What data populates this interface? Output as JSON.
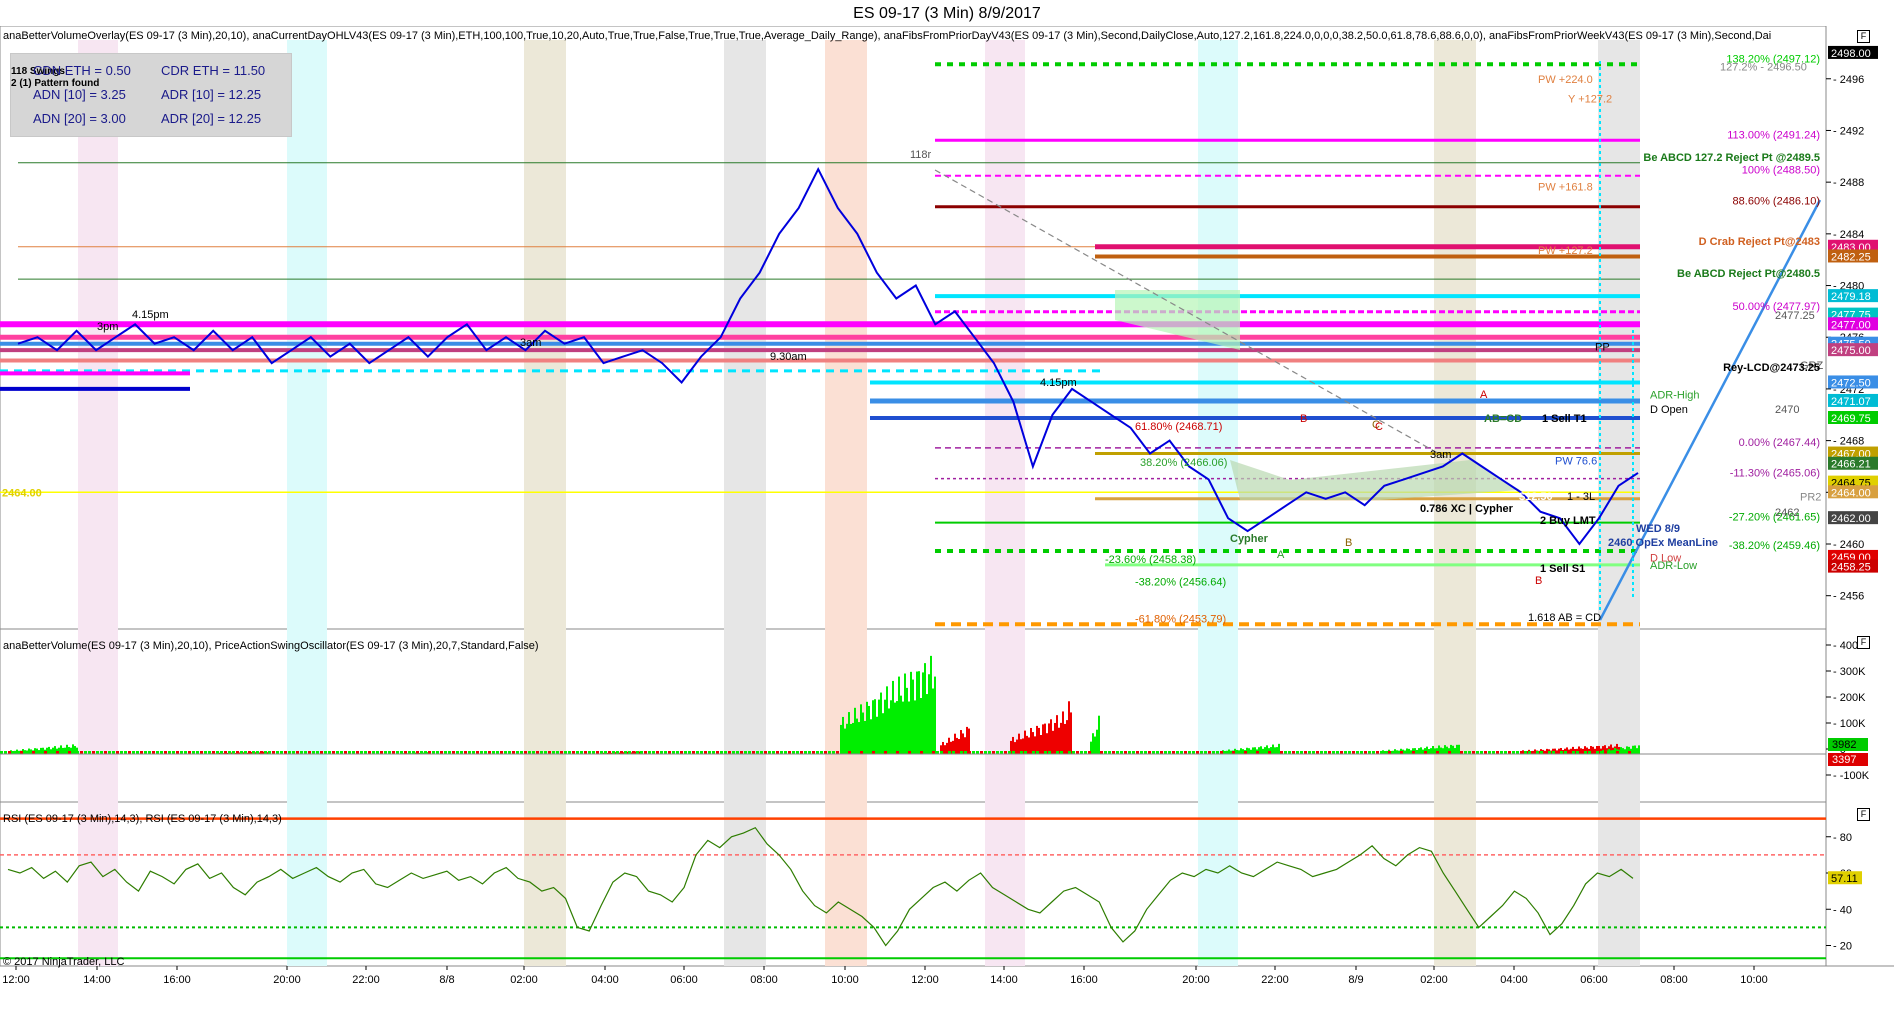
{
  "window": {
    "title": "ES 09-17 (3 Min)  8/9/2017"
  },
  "panels": {
    "price_label": "anaBetterVolumeOverlay(ES 09-17 (3 Min),20,10), anaCurrentDayOHLV43(ES 09-17 (3 Min),ETH,100,100,True,10,20,Auto,True,True,False,True,True,True,Average_Daily_Range), anaFibsFromPriorDayV43(ES 09-17 (3 Min),Second,DailyClose,Auto,127.2,161.8,224.0,0,0,0,38.2,50.0,61.8,78.6,88.6,0,0), anaFibsFromPriorWeekV43(ES 09-17 (3 Min),Second,Dai",
    "volume_label": "anaBetterVolume(ES 09-17 (3 Min),20,10), PriceActionSwingOscillator(ES 09-17 (3 Min),20,7,Standard,False)",
    "rsi_label": "RSI (ES 09-17 (3 Min),14,3), RSI (ES 09-17 (3 Min),14,3)"
  },
  "info_box": {
    "cdn_eth": "CDN ETH = 0.50",
    "cdr_eth": "CDR ETH = 11.50",
    "adn10": "ADN [10] = 3.25",
    "adr10": "ADR [10] = 12.25",
    "adn20": "ADN [20] = 3.00",
    "adr20": "ADR [20] = 12.25",
    "swings": "118 Swings",
    "pattern": "2 (1) Pattern found"
  },
  "copyright": "© 2017 NinjaTrader, LLC",
  "colors": {
    "fib_green": "#00cc00",
    "magenta": "#ff00ff",
    "blue": "#0000dd",
    "cyan": "#00e5ff",
    "orange": "#ff9900",
    "darkred": "#8b0000",
    "yellow": "#ffff00",
    "rsi": "#2e7d00",
    "vol_up": "#00ee00",
    "vol_down": "#ee0000",
    "steel": "#3a8ee6"
  },
  "chart_data": [
    {
      "type": "line",
      "panel": "price",
      "ylim": [
        2453.5,
        2499
      ],
      "y_ticks": [
        2456,
        2460,
        2464,
        2468,
        2472,
        2476,
        2480,
        2484,
        2488,
        2492,
        2496
      ],
      "x_tick_labels": [
        "12:00",
        "14:00",
        "16:00",
        "20:00",
        "22:00",
        "8/8",
        "02:00",
        "04:00",
        "06:00",
        "08:00",
        "10:00",
        "12:00",
        "14:00",
        "16:00",
        "20:00",
        "22:00",
        "8/9",
        "02:00",
        "04:00",
        "06:00",
        "08:00",
        "10:00"
      ],
      "current_price": 2464.0,
      "left_price_label": "2464.00",
      "series": [
        {
          "values": [
            2475.5,
            2476,
            2475,
            2476.5,
            2475,
            2476,
            2477,
            2475.5,
            2476,
            2475,
            2476.5,
            2475,
            2476,
            2474,
            2475,
            2476,
            2474.5,
            2475.5,
            2474,
            2475,
            2476,
            2474.5,
            2476,
            2477,
            2475,
            2476,
            2475,
            2476.5,
            2475.5,
            2476,
            2474,
            2474.5,
            2475,
            2474,
            2472.5,
            2474.5,
            2476,
            2479,
            2481,
            2484,
            2486,
            2489,
            2486,
            2484,
            2481,
            2479,
            2480,
            2477,
            2478,
            2476,
            2474,
            2471,
            2466,
            2470,
            2472,
            2471,
            2470,
            2469,
            2467,
            2468,
            2466,
            2465,
            2462,
            2461,
            2462,
            2463,
            2464,
            2463.5,
            2464,
            2463,
            2464.5,
            2465,
            2465.5,
            2466,
            2467,
            2466,
            2465,
            2464,
            2462.5,
            2462,
            2460,
            2462,
            2464.5,
            2465.5
          ]
        }
      ],
      "levels": [
        {
          "label": "138.20% (2497.12)",
          "value": 2497.12
        },
        {
          "label": "127.2% - 2496.50",
          "value": 2496.5
        },
        {
          "label": "PW +224.0",
          "value": 2495.5
        },
        {
          "label": "Y +127.2",
          "value": 2494
        },
        {
          "label": "113.00% (2491.24)",
          "value": 2491.24
        },
        {
          "label": "Be ABCD 127.2 Reject Pt @2489.5",
          "value": 2489.5
        },
        {
          "label": "100% (2488.50)",
          "value": 2488.5
        },
        {
          "label": "PW +161.8",
          "value": 2487.2
        },
        {
          "label": "88.60% (2486.10)",
          "value": 2486.1
        },
        {
          "label": "D Crab Reject Pt@2483",
          "value": 2483
        },
        {
          "label": "PW +127.2",
          "value": 2482.3
        },
        {
          "label": "Be ABCD Reject Pt@2480.5",
          "value": 2480.5
        },
        {
          "label": "50.00% (2477.97)",
          "value": 2477.97
        },
        {
          "label": "2477.25",
          "value": 2477.25
        },
        {
          "label": "PP",
          "value": 2474.8
        },
        {
          "label": "GRZ",
          "value": 2473.4
        },
        {
          "label": "Rey-LCD@2473.25",
          "value": 2473.25
        },
        {
          "label": "ADR-High",
          "value": 2471.1
        },
        {
          "label": "D Open",
          "value": 2470
        },
        {
          "label": "2470",
          "value": 2470
        },
        {
          "label": "0.00% (2467.44)",
          "value": 2467.44
        },
        {
          "label": "PW 76.6",
          "value": 2466
        },
        {
          "label": "-11.30% (2465.06)",
          "value": 2465.06
        },
        {
          "label": "PR2",
          "value": 2463.2
        },
        {
          "label": "-27.20% (2461.65)",
          "value": 2461.65
        },
        {
          "label": "2462",
          "value": 2462
        },
        {
          "label": "-38.20% (2459.46)",
          "value": 2459.46
        },
        {
          "label": "D Low",
          "value": 2458.5
        },
        {
          "label": "ADR-Low",
          "value": 2457.9
        },
        {
          "label": "-23.60% (2458.38)",
          "value": 2458.38
        },
        {
          "label": "-38.20% (2456.64)",
          "value": 2456.64
        },
        {
          "label": "-61.80% (2453.79)",
          "value": 2453.79
        },
        {
          "label": "1.618 AB = CD",
          "value": 2453.9
        }
      ],
      "axis_badges": [
        "2498.00",
        "2483.00",
        "2482.25",
        "2479.18",
        "2477.75",
        "2477.00",
        "2475.50",
        "2475.00",
        "2472.50",
        "2471.07",
        "2469.75",
        "2467.00",
        "2466.21",
        "2464.75",
        "2464.00",
        "2462.00",
        "2459.00",
        "2458.25"
      ],
      "annotations": [
        "118r",
        "3pm",
        "4.15pm",
        "9.30am",
        "3am",
        "4.15pm",
        "61.80% (2468.71)",
        "38.20% (2466.06)",
        "Cypher",
        "A",
        "B",
        "A",
        "B",
        "C",
        "AB=CD",
        "3am",
        "0.786 XC | Cypher",
        "$12.50",
        "1 - 3L",
        "2 Buy LMT",
        "1 Sell T1",
        "1 Sell S1",
        "WED 8/9",
        "2460 OpEx MeanLine",
        "B",
        "C"
      ]
    },
    {
      "type": "bar",
      "panel": "volume",
      "y_ticks": [
        "400K",
        "300K",
        "200K",
        "100K",
        "0",
        "-100K"
      ],
      "badges": [
        "3982",
        "3397"
      ]
    },
    {
      "type": "line",
      "panel": "rsi",
      "ylim": [
        12,
        92
      ],
      "y_ticks": [
        20,
        40,
        60,
        80
      ],
      "current_value": "57.11",
      "series": [
        {
          "values": [
            62,
            60,
            63,
            57,
            61,
            55,
            64,
            66,
            58,
            62,
            55,
            50,
            61,
            58,
            54,
            62,
            65,
            57,
            60,
            52,
            48,
            55,
            58,
            62,
            57,
            60,
            63,
            58,
            55,
            60,
            62,
            54,
            52,
            56,
            60,
            57,
            59,
            61,
            56,
            58,
            54,
            60,
            63,
            57,
            55,
            50,
            52,
            46,
            30,
            28,
            42,
            55,
            60,
            58,
            50,
            48,
            44,
            52,
            70,
            78,
            74,
            80,
            82,
            85,
            76,
            70,
            62,
            50,
            42,
            38,
            44,
            40,
            36,
            30,
            20,
            28,
            40,
            46,
            52,
            55,
            50,
            56,
            60,
            52,
            48,
            44,
            40,
            38,
            44,
            50,
            52,
            48,
            44,
            30,
            22,
            28,
            40,
            48,
            56,
            60,
            58,
            62,
            60,
            64,
            60,
            58,
            62,
            66,
            64,
            62,
            58,
            60,
            62,
            66,
            70,
            75,
            68,
            64,
            70,
            74,
            72,
            60,
            50,
            40,
            30,
            36,
            42,
            50,
            46,
            38,
            26,
            32,
            42,
            54,
            60,
            58,
            62,
            57
          ]
        }
      ]
    }
  ]
}
